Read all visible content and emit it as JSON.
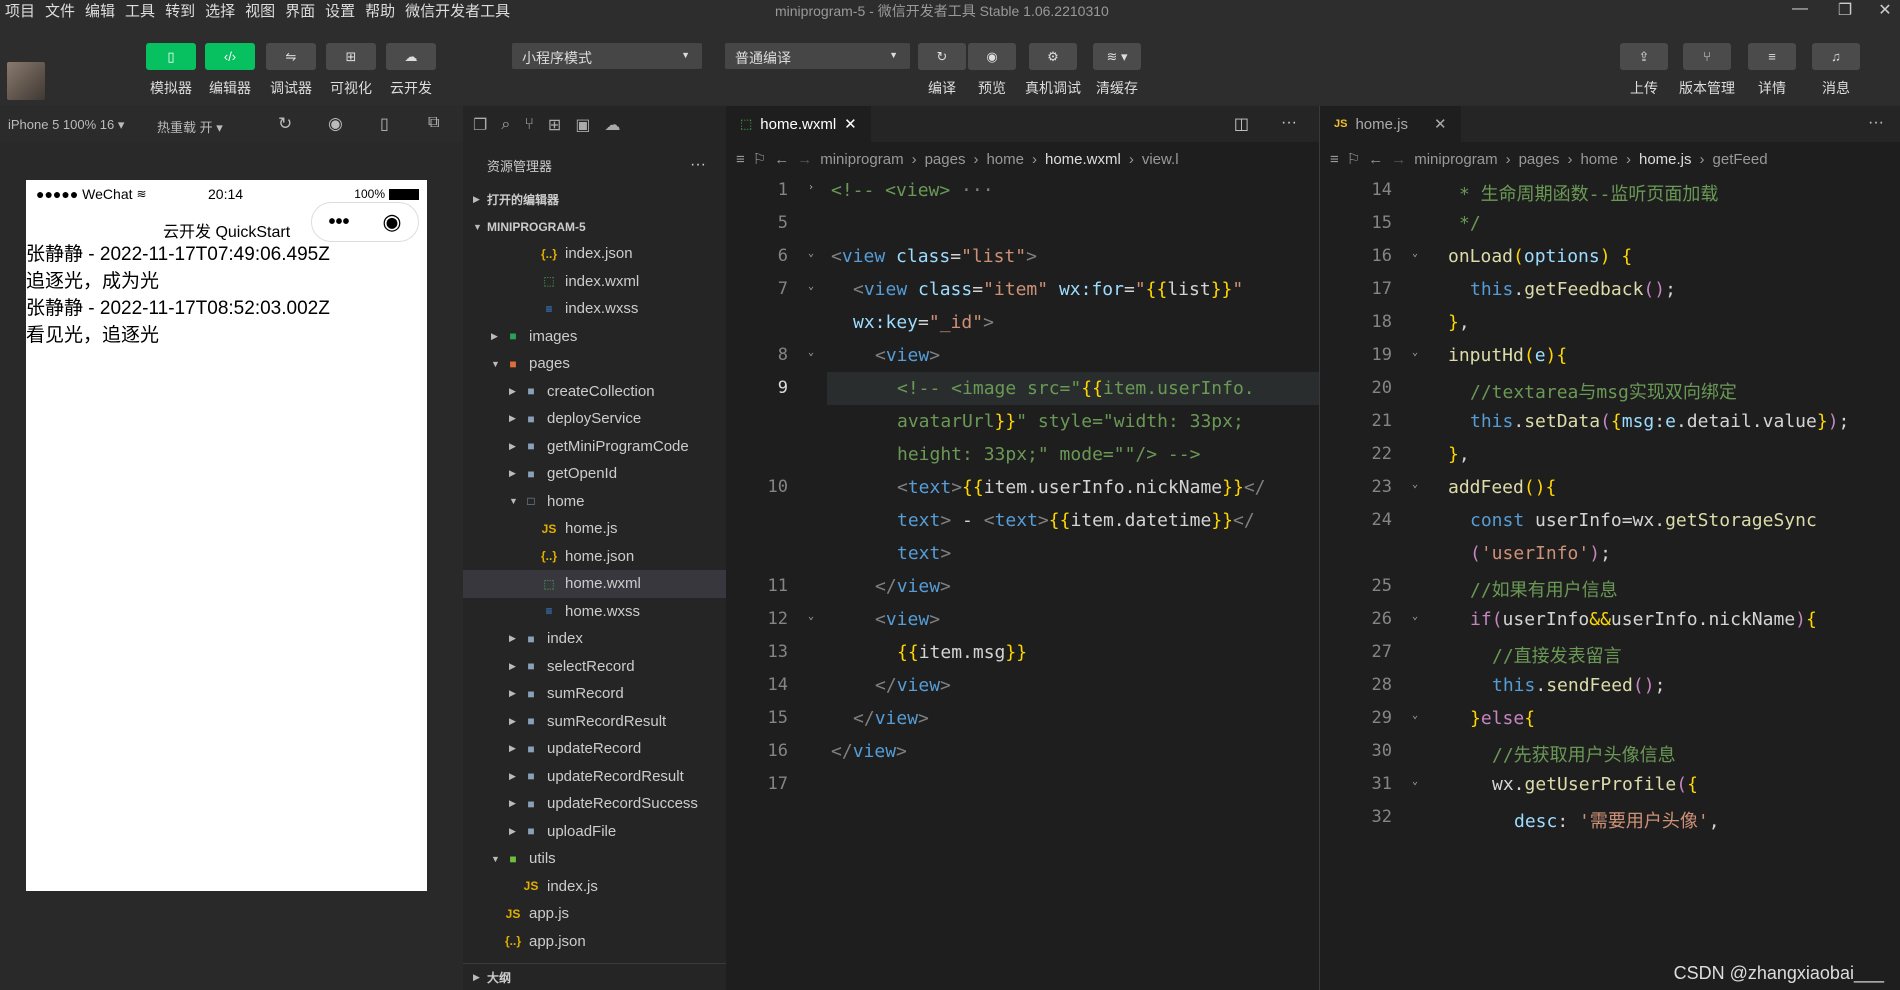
{
  "menu": [
    "项目",
    "文件",
    "编辑",
    "工具",
    "转到",
    "选择",
    "视图",
    "界面",
    "设置",
    "帮助",
    "微信开发者工具"
  ],
  "window_title": "miniprogram-5 - 微信开发者工具 Stable 1.06.2210310",
  "toolbar": {
    "left_buttons": [
      {
        "label": "模拟器",
        "icon": "phone-icon",
        "active": true
      },
      {
        "label": "编辑器",
        "icon": "code-icon",
        "active": true
      },
      {
        "label": "调试器",
        "icon": "debug-icon",
        "active": false
      },
      {
        "label": "可视化",
        "icon": "layout-icon",
        "active": false
      },
      {
        "label": "云开发",
        "icon": "cloud-icon",
        "active": false
      }
    ],
    "mode_select": "小程序模式",
    "compile_select": "普通编译",
    "mid_buttons": [
      {
        "label": "编译",
        "icon": "refresh-icon"
      },
      {
        "label": "预览",
        "icon": "eye-icon"
      },
      {
        "label": "真机调试",
        "icon": "bug-icon"
      },
      {
        "label": "清缓存",
        "icon": "layers-icon"
      }
    ],
    "right_buttons": [
      {
        "label": "上传",
        "icon": "upload-icon"
      },
      {
        "label": "版本管理",
        "icon": "branch-icon"
      },
      {
        "label": "详情",
        "icon": "menu-icon"
      },
      {
        "label": "消息",
        "icon": "bell-icon"
      }
    ]
  },
  "simulator": {
    "device": "iPhone 5 100% 16 ▾",
    "hot_reload": "热重载 开 ▾",
    "status_left": "●●●●● WeChat",
    "status_time": "20:14",
    "status_battery": "100%",
    "nav_title": "云开发 QuickStart",
    "lines": [
      "张静静 - 2022-11-17T07:49:06.495Z",
      "追逐光，成为光",
      "张静静 - 2022-11-17T08:52:03.002Z",
      "看见光，追逐光"
    ]
  },
  "explorer": {
    "title": "资源管理器",
    "open_editors": "打开的编辑器",
    "project": "MINIPROGRAM-5",
    "outline": "大纲",
    "tree": [
      {
        "label": "index.json",
        "icon": "json",
        "depth": 3,
        "arrow": ""
      },
      {
        "label": "index.wxml",
        "icon": "wxml",
        "depth": 3,
        "arrow": ""
      },
      {
        "label": "index.wxss",
        "icon": "wxss",
        "depth": 3,
        "arrow": ""
      },
      {
        "label": "images",
        "icon": "folder-img",
        "depth": 1,
        "arrow": "▶"
      },
      {
        "label": "pages",
        "icon": "folder-pages",
        "depth": 1,
        "arrow": "▼"
      },
      {
        "label": "createCollection",
        "icon": "folder",
        "depth": 2,
        "arrow": "▶"
      },
      {
        "label": "deployService",
        "icon": "folder",
        "depth": 2,
        "arrow": "▶"
      },
      {
        "label": "getMiniProgramCode",
        "icon": "folder",
        "depth": 2,
        "arrow": "▶"
      },
      {
        "label": "getOpenId",
        "icon": "folder",
        "depth": 2,
        "arrow": "▶"
      },
      {
        "label": "home",
        "icon": "folder-open",
        "depth": 2,
        "arrow": "▼"
      },
      {
        "label": "home.js",
        "icon": "js",
        "depth": 3,
        "arrow": ""
      },
      {
        "label": "home.json",
        "icon": "json",
        "depth": 3,
        "arrow": ""
      },
      {
        "label": "home.wxml",
        "icon": "wxml",
        "depth": 3,
        "arrow": "",
        "selected": true
      },
      {
        "label": "home.wxss",
        "icon": "wxss",
        "depth": 3,
        "arrow": ""
      },
      {
        "label": "index",
        "icon": "folder",
        "depth": 2,
        "arrow": "▶"
      },
      {
        "label": "selectRecord",
        "icon": "folder",
        "depth": 2,
        "arrow": "▶"
      },
      {
        "label": "sumRecord",
        "icon": "folder",
        "depth": 2,
        "arrow": "▶"
      },
      {
        "label": "sumRecordResult",
        "icon": "folder",
        "depth": 2,
        "arrow": "▶"
      },
      {
        "label": "updateRecord",
        "icon": "folder",
        "depth": 2,
        "arrow": "▶"
      },
      {
        "label": "updateRecordResult",
        "icon": "folder",
        "depth": 2,
        "arrow": "▶"
      },
      {
        "label": "updateRecordSuccess",
        "icon": "folder",
        "depth": 2,
        "arrow": "▶"
      },
      {
        "label": "uploadFile",
        "icon": "folder",
        "depth": 2,
        "arrow": "▶"
      },
      {
        "label": "utils",
        "icon": "folder-utils",
        "depth": 1,
        "arrow": "▼"
      },
      {
        "label": "index.js",
        "icon": "js",
        "depth": 2,
        "arrow": ""
      },
      {
        "label": "app.js",
        "icon": "js",
        "depth": 1,
        "arrow": ""
      },
      {
        "label": "app.json",
        "icon": "json",
        "depth": 1,
        "arrow": ""
      }
    ]
  },
  "editor1": {
    "tab": "home.wxml",
    "crumbs": [
      "miniprogram",
      "pages",
      "home",
      "home.wxml",
      "view.l"
    ],
    "rows": [
      {
        "ln": "1",
        "fold": "›",
        "h": [
          [
            "c",
            "<!-- <view>"
          ],
          [
            "g",
            " ···"
          ]
        ],
        "ind": 0
      },
      {
        "ln": "5",
        "h": [],
        "ind": 0
      },
      {
        "ln": "6",
        "fold": "⌄",
        "h": [
          [
            "g",
            "<"
          ],
          [
            "k",
            "view"
          ],
          [
            "a",
            " class"
          ],
          [
            "o",
            "="
          ],
          [
            "s",
            "\"list\""
          ],
          [
            "g",
            ">"
          ]
        ],
        "ind": 0
      },
      {
        "ln": "7",
        "fold": "⌄",
        "h": [
          [
            "g",
            "<"
          ],
          [
            "k",
            "view"
          ],
          [
            "a",
            " class"
          ],
          [
            "o",
            "="
          ],
          [
            "s",
            "\"item\""
          ],
          [
            "a",
            " wx:for"
          ],
          [
            "o",
            "="
          ],
          [
            "s",
            "\""
          ],
          [
            "y",
            "{{"
          ],
          [
            "o",
            "list"
          ],
          [
            "y",
            "}}"
          ],
          [
            "s",
            "\""
          ]
        ],
        "ind": 1
      },
      {
        "ln": "",
        "h": [
          [
            "a",
            "wx:key"
          ],
          [
            "o",
            "="
          ],
          [
            "s",
            "\"_id\""
          ],
          [
            "g",
            ">"
          ]
        ],
        "ind": 1
      },
      {
        "ln": "8",
        "fold": "⌄",
        "h": [
          [
            "g",
            "<"
          ],
          [
            "k",
            "view"
          ],
          [
            "g",
            ">"
          ]
        ],
        "ind": 2
      },
      {
        "ln": "9",
        "cur": true,
        "h": [
          [
            "c",
            "<!-- <image src=\""
          ],
          [
            "y",
            "{{"
          ],
          [
            "c",
            "item.userInfo."
          ]
        ],
        "ind": 3
      },
      {
        "ln": "",
        "h": [
          [
            "c",
            "avatarUrl"
          ],
          [
            "y",
            "}}"
          ],
          [
            "c",
            "\" style=\"width: 33px;"
          ]
        ],
        "ind": 3
      },
      {
        "ln": "",
        "h": [
          [
            "c",
            "height: 33px;\" mode=\"\"/> -->"
          ]
        ],
        "ind": 3
      },
      {
        "ln": "10",
        "h": [
          [
            "g",
            "<"
          ],
          [
            "k",
            "text"
          ],
          [
            "g",
            ">"
          ],
          [
            "y",
            "{{"
          ],
          [
            "o",
            "item.userInfo.nickName"
          ],
          [
            "y",
            "}}"
          ],
          [
            "g",
            "</"
          ]
        ],
        "ind": 3
      },
      {
        "ln": "",
        "h": [
          [
            "k",
            "text"
          ],
          [
            "g",
            ">"
          ],
          [
            "o",
            " - "
          ],
          [
            "g",
            "<"
          ],
          [
            "k",
            "text"
          ],
          [
            "g",
            ">"
          ],
          [
            "y",
            "{{"
          ],
          [
            "o",
            "item.datetime"
          ],
          [
            "y",
            "}}"
          ],
          [
            "g",
            "</"
          ]
        ],
        "ind": 3
      },
      {
        "ln": "",
        "h": [
          [
            "k",
            "text"
          ],
          [
            "g",
            ">"
          ]
        ],
        "ind": 3
      },
      {
        "ln": "11",
        "h": [
          [
            "g",
            "</"
          ],
          [
            "k",
            "view"
          ],
          [
            "g",
            ">"
          ]
        ],
        "ind": 2
      },
      {
        "ln": "12",
        "fold": "⌄",
        "h": [
          [
            "g",
            "<"
          ],
          [
            "k",
            "view"
          ],
          [
            "g",
            ">"
          ]
        ],
        "ind": 2
      },
      {
        "ln": "13",
        "h": [
          [
            "y",
            "{{"
          ],
          [
            "o",
            "item.msg"
          ],
          [
            "y",
            "}}"
          ]
        ],
        "ind": 3
      },
      {
        "ln": "14",
        "h": [
          [
            "g",
            "</"
          ],
          [
            "k",
            "view"
          ],
          [
            "g",
            ">"
          ]
        ],
        "ind": 2
      },
      {
        "ln": "15",
        "h": [
          [
            "g",
            "</"
          ],
          [
            "k",
            "view"
          ],
          [
            "g",
            ">"
          ]
        ],
        "ind": 1
      },
      {
        "ln": "16",
        "h": [
          [
            "g",
            "</"
          ],
          [
            "k",
            "view"
          ],
          [
            "g",
            ">"
          ]
        ],
        "ind": 0
      },
      {
        "ln": "17",
        "h": [],
        "ind": 0
      }
    ]
  },
  "editor2": {
    "tab": "home.js",
    "crumbs": [
      "miniprogram",
      "pages",
      "home",
      "home.js",
      "getFeed"
    ],
    "rows": [
      {
        "ln": "14",
        "h": [
          [
            "c",
            "* 生命周期函数--监听页面加载"
          ]
        ],
        "ind": 0.5
      },
      {
        "ln": "15",
        "h": [
          [
            "c",
            "*/"
          ]
        ],
        "ind": 0.5
      },
      {
        "ln": "16",
        "fold": "⌄",
        "h": [
          [
            "f",
            "onLoad"
          ],
          [
            "y",
            "("
          ],
          [
            "a",
            "options"
          ],
          [
            "y",
            ")"
          ],
          [
            "o",
            " "
          ],
          [
            "y",
            "{"
          ]
        ],
        "ind": 0
      },
      {
        "ln": "17",
        "h": [
          [
            "k",
            "this"
          ],
          [
            "o",
            "."
          ],
          [
            "f",
            "getFeedback"
          ],
          [
            "p",
            "()"
          ],
          [
            "o",
            ";"
          ]
        ],
        "ind": 1
      },
      {
        "ln": "18",
        "h": [
          [
            "y",
            "}"
          ],
          [
            "o",
            ","
          ]
        ],
        "ind": 0
      },
      {
        "ln": "19",
        "fold": "⌄",
        "h": [
          [
            "f",
            "inputHd"
          ],
          [
            "y",
            "("
          ],
          [
            "a",
            "e"
          ],
          [
            "y",
            ")"
          ],
          [
            "y",
            "{"
          ]
        ],
        "ind": 0
      },
      {
        "ln": "20",
        "h": [
          [
            "c",
            "//textarea与msg实现双向绑定"
          ]
        ],
        "ind": 1
      },
      {
        "ln": "21",
        "h": [
          [
            "k",
            "this"
          ],
          [
            "o",
            "."
          ],
          [
            "f",
            "setData"
          ],
          [
            "p",
            "("
          ],
          [
            "y",
            "{"
          ],
          [
            "a",
            "msg"
          ],
          [
            "o",
            ":"
          ],
          [
            "a",
            "e"
          ],
          [
            "o",
            ".detail.value"
          ],
          [
            "y",
            "}"
          ],
          [
            "p",
            ")"
          ],
          [
            "o",
            ";"
          ]
        ],
        "ind": 1
      },
      {
        "ln": "22",
        "h": [
          [
            "y",
            "}"
          ],
          [
            "o",
            ","
          ]
        ],
        "ind": 0
      },
      {
        "ln": "23",
        "fold": "⌄",
        "h": [
          [
            "f",
            "addFeed"
          ],
          [
            "y",
            "()"
          ],
          [
            "y",
            "{"
          ]
        ],
        "ind": 0
      },
      {
        "ln": "24",
        "h": [
          [
            "k",
            "const"
          ],
          [
            "o",
            " userInfo=wx."
          ],
          [
            "f",
            "getStorageSync"
          ]
        ],
        "ind": 1
      },
      {
        "ln": "",
        "h": [
          [
            "p",
            "("
          ],
          [
            "s",
            "'userInfo'"
          ],
          [
            "p",
            ")"
          ],
          [
            "o",
            ";"
          ]
        ],
        "ind": 1
      },
      {
        "ln": "25",
        "h": [
          [
            "c",
            "//如果有用户信息"
          ]
        ],
        "ind": 1
      },
      {
        "ln": "26",
        "fold": "⌄",
        "h": [
          [
            "p",
            "if"
          ],
          [
            "p",
            "("
          ],
          [
            "o",
            "userInfo"
          ],
          [
            "y",
            "&&"
          ],
          [
            "o",
            "userInfo.nickName"
          ],
          [
            "p",
            ")"
          ],
          [
            "y",
            "{"
          ]
        ],
        "ind": 1
      },
      {
        "ln": "27",
        "h": [
          [
            "c",
            "//直接发表留言"
          ]
        ],
        "ind": 2
      },
      {
        "ln": "28",
        "h": [
          [
            "k",
            "this"
          ],
          [
            "o",
            "."
          ],
          [
            "f",
            "sendFeed"
          ],
          [
            "p",
            "()"
          ],
          [
            "o",
            ";"
          ]
        ],
        "ind": 2
      },
      {
        "ln": "29",
        "fold": "⌄",
        "h": [
          [
            "y",
            "}"
          ],
          [
            "p",
            "else"
          ],
          [
            "y",
            "{"
          ]
        ],
        "ind": 1
      },
      {
        "ln": "30",
        "h": [
          [
            "c",
            "//先获取用户头像信息"
          ]
        ],
        "ind": 2
      },
      {
        "ln": "31",
        "fold": "⌄",
        "h": [
          [
            "o",
            "wx."
          ],
          [
            "f",
            "getUserProfile"
          ],
          [
            "p",
            "("
          ],
          [
            "y",
            "{"
          ]
        ],
        "ind": 2
      },
      {
        "ln": "32",
        "h": [
          [
            "a",
            "desc"
          ],
          [
            "o",
            ": "
          ],
          [
            "s",
            "'需要用户头像'"
          ],
          [
            "o",
            ","
          ]
        ],
        "ind": 3
      }
    ]
  },
  "watermark": "CSDN @zhangxiaobai___"
}
